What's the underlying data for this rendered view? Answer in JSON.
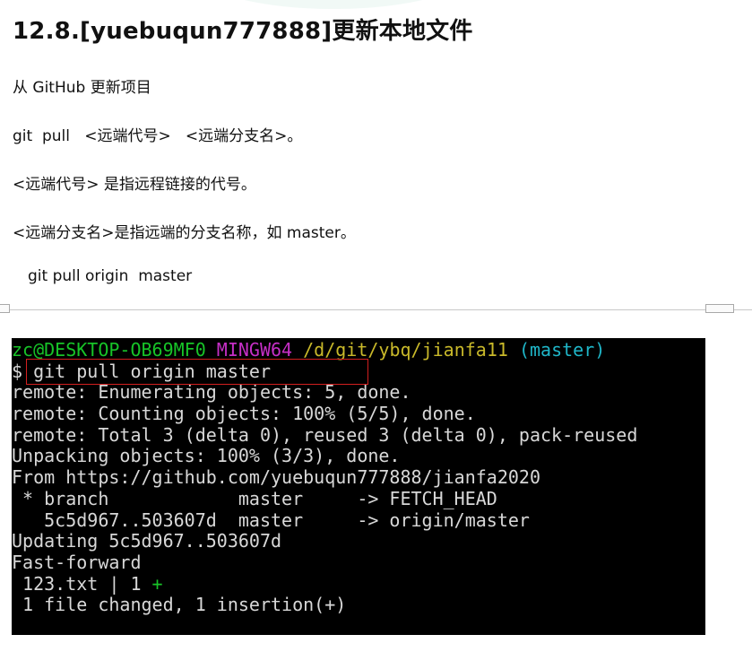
{
  "title": "12.8.[yuebuqun777888]更新本地文件",
  "paragraphs": {
    "p1": "从 GitHub 更新项目",
    "p2": "git  pull   <远端代号>   <远端分支名>。",
    "p3": "<远端代号> 是指远程链接的代号。",
    "p4": "<远端分支名>是指远端的分支名称，如 master。",
    "p5": "git pull origin  master"
  },
  "terminal": {
    "prompt_user": "zc@DESKTOP-OB69MF0",
    "prompt_env": "MINGW64",
    "prompt_path": "/d/git/ybq/jianfa11",
    "prompt_branch": "(master)",
    "prompt_symbol": "$",
    "command": "git pull origin master",
    "lines": [
      "remote: Enumerating objects: 5, done.",
      "remote: Counting objects: 100% (5/5), done.",
      "remote: Total 3 (delta 0), reused 3 (delta 0), pack-reused",
      "Unpacking objects: 100% (3/3), done.",
      "From https://github.com/yuebuqun777888/jianfa2020",
      " * branch            master     -> FETCH_HEAD",
      "   5c5d967..503607d  master     -> origin/master",
      "Updating 5c5d967..503607d",
      "Fast-forward"
    ],
    "diffstat_file": " 123.txt | 1 ",
    "diffstat_plus": "+",
    "summary": " 1 file changed, 1 insertion(+)"
  },
  "colors": {
    "terminal_bg": "#000000",
    "prompt_green": "#17c428",
    "prompt_purple": "#c62fc6",
    "prompt_yellow": "#c9b92a",
    "prompt_cyan": "#1fb6c8",
    "highlight_box": "#d21f1f"
  }
}
